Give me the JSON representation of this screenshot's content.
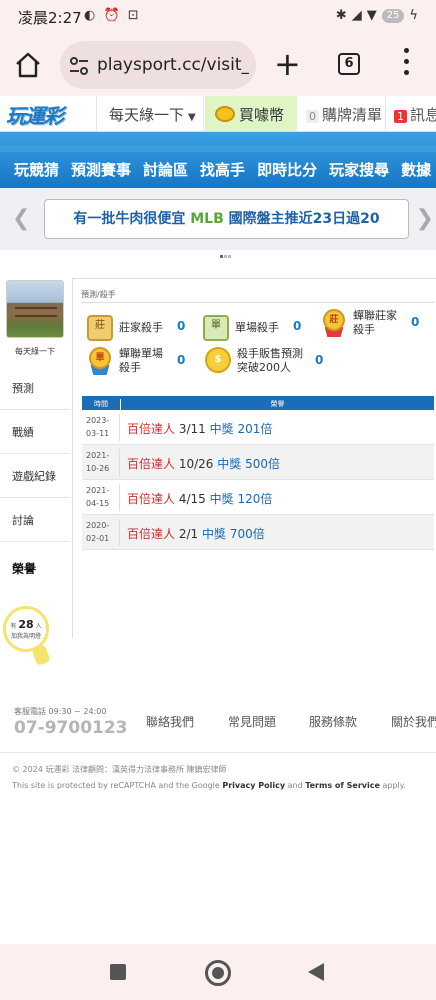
{
  "status_bar": {
    "time": "凌晨2:27",
    "battery": "25"
  },
  "browser": {
    "url": "playsport.cc/visit_m",
    "tab_count": "6"
  },
  "site_nav": {
    "logo": "玩運彩",
    "dropdown": "每天綠一下",
    "coin_button": "買噱幣",
    "cart_count": "0",
    "cart_label": "購牌清單",
    "msg_count": "1",
    "msg_label": "訊息"
  },
  "main_menu": [
    "玩競猜",
    "預測賽事",
    "討論區",
    "找高手",
    "即時比分",
    "玩家搜尋",
    "數據"
  ],
  "banner": {
    "pre": "有一批牛肉很便宜 ",
    "mlb": "MLB",
    "post": " 國際盤主推近23日過20"
  },
  "sidebar": {
    "username": "每天綠一下",
    "items": [
      "預測",
      "戰績",
      "遊戲紀錄",
      "討論"
    ],
    "active_item": "榮譽",
    "followers_pre": "有",
    "followers_count": "28",
    "followers_unit": "人",
    "followers_post": "加我為明燈"
  },
  "panel": {
    "breadcrumb": "預測/殺手",
    "badges": [
      {
        "icon": "莊",
        "label": "莊家殺手",
        "count": "0"
      },
      {
        "icon": "單",
        "label": "單場殺手",
        "count": "0"
      },
      {
        "icon": "莊",
        "label_line1": "蟬聯莊家",
        "label_line2": "殺手",
        "count": "0"
      },
      {
        "icon": "單",
        "label_line1": "蟬聯單場",
        "label_line2": "殺手",
        "count": "0"
      },
      {
        "icon": "$",
        "label_line1": "殺手販售預測",
        "label_line2": "突破200人",
        "count": "0"
      }
    ],
    "table_headers": [
      "時間",
      "榮譽"
    ],
    "table_rows": [
      {
        "year": "2023-",
        "md": "03-11",
        "title": "百倍達人",
        "date": "3/11",
        "prize": "中獎",
        "amount": "201倍"
      },
      {
        "year": "2021-",
        "md": "10-26",
        "title": "百倍達人",
        "date": "10/26",
        "prize": "中獎",
        "amount": "500倍"
      },
      {
        "year": "2021-",
        "md": "04-15",
        "title": "百倍達人",
        "date": "4/15",
        "prize": "中獎",
        "amount": "120倍"
      },
      {
        "year": "2020-",
        "md": "02-01",
        "title": "百倍達人",
        "date": "2/1",
        "prize": "中獎",
        "amount": "700倍"
      }
    ]
  },
  "footer": {
    "hours": "客服電話 09:30 ~ 24:00",
    "phone": "07-9700123",
    "links": [
      "聯絡我們",
      "常見問題",
      "服務條款",
      "關於我們"
    ],
    "copyright": "© 2024 玩運彩 法律顧問：漢英得力法律事務所 陳鎮宏律師",
    "recaptcha_pre": "This site is protected by reCAPTCHA and the Google ",
    "privacy": "Privacy Policy",
    "and": " and ",
    "terms": "Terms of Service",
    "apply": " apply."
  }
}
